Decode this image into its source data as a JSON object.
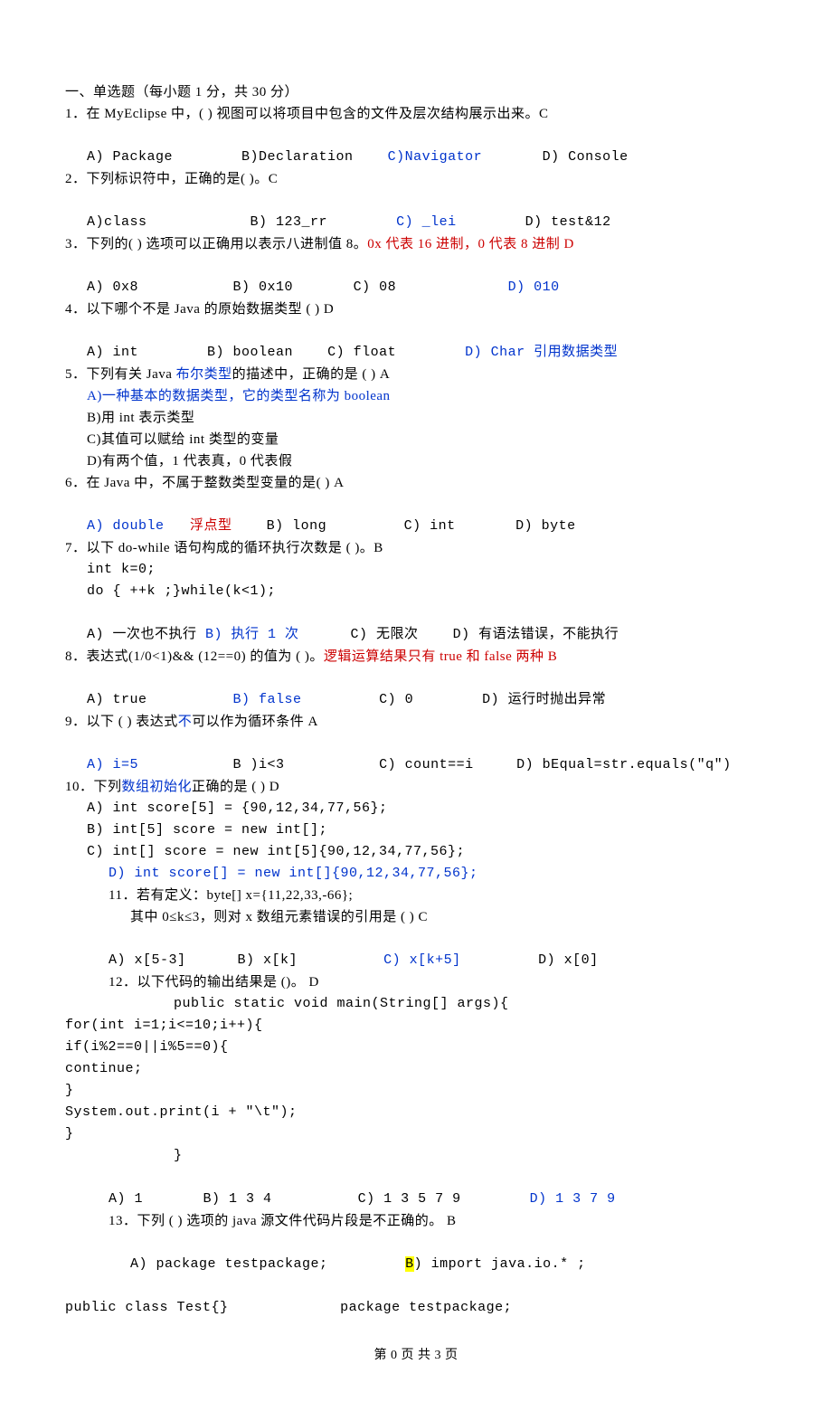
{
  "header": "一、单选题（每小题 1 分，共 30 分）",
  "q1": {
    "stem_a": "1．在 MyEclipse 中，(  ) 视图可以将项目中包含的文件及层次结构展示出来。C",
    "optA": "A) Package",
    "optB": "B)Declaration",
    "optC": "C)Navigator",
    "optD": "D) Console"
  },
  "q2": {
    "stem": "2．下列标识符中，正确的是(  )。C",
    "optA": "A)class",
    "optB": "B) 123_rr",
    "optC": "C) _lei",
    "optD": "D) test&12"
  },
  "q3": {
    "stem_a": "3．下列的(  ) 选项可以正确用以表示八进制值 8。",
    "stem_b": "0x 代表 16 进制，0 代表 8 进制 D",
    "optA": "A) 0x8",
    "optB": "B) 0x10",
    "optC": "C) 08",
    "optD": "D) 010"
  },
  "q4": {
    "stem": "4．以下哪个不是 Java 的原始数据类型 (  ) D",
    "optA": "A) int",
    "optB": "B) boolean",
    "optC": "C) float",
    "optD": "D) Char 引用数据类型"
  },
  "q5": {
    "stem_a": "5．下列有关 Java ",
    "stem_b": "布尔类型",
    "stem_c": "的描述中，正确的是 (  ) A",
    "optA": "A)一种基本的数据类型，它的类型名称为 boolean",
    "optB": "B)用 int 表示类型",
    "optC": "C)其值可以赋给 int 类型的变量",
    "optD": "D)有两个值，1 代表真，0 代表假"
  },
  "q6": {
    "stem": "6．在 Java 中，不属于整数类型变量的是(   ) A",
    "optA_a": "A) double",
    "optA_b": "浮点型",
    "optB": "B) long",
    "optC": "C) int",
    "optD": "D) byte"
  },
  "q7": {
    "stem": "7．以下 do-while 语句构成的循环执行次数是 (  )。B",
    "code1": "int k=0;",
    "code2": "do { ++k ;}while(k<1);",
    "optA": "A) 一次也不执行 ",
    "optB": "B) 执行 1 次",
    "optC": "C) 无限次",
    "optD": "D) 有语法错误，不能执行"
  },
  "q8": {
    "stem_a": "8．表达式(1/0<1)&& (12==0) 的值为 (  )。",
    "stem_b": "逻辑运算结果只有 true 和 false 两种 B",
    "optA": "A) true",
    "optB": "B) false",
    "optC": "C) 0",
    "optD": "D) 运行时抛出异常"
  },
  "q9": {
    "stem_a": "9．以下 (  ) 表达式",
    "stem_b": "不",
    "stem_c": "可以作为循环条件 A",
    "optA": "A) i=5",
    "optB": "B )i<3",
    "optC": "C) count==i",
    "optD": "D) bEqual=str.equals(\"q\")"
  },
  "q10": {
    "stem_a": "10．下列",
    "stem_b": "数组初始化",
    "stem_c": "正确的是 (  )  D",
    "optA": "A) int score[5] = {90,12,34,77,56};",
    "optB": "B) int[5] score = new int[];",
    "optC": "C) int[] score = new int[5]{90,12,34,77,56};",
    "optD": "D) int score[] = new int[]{90,12,34,77,56};"
  },
  "q11": {
    "stem1": "11．若有定义：byte[] x={11,22,33,-66};",
    "stem2": "其中 0≤k≤3，则对 x 数组元素错误的引用是 (  )  C",
    "optA": "A) x[5-3]",
    "optB": "B) x[k]",
    "optC": "C) x[k+5]",
    "optD": "D) x[0]"
  },
  "q12": {
    "stem": "12．以下代码的输出结果是 ()。 D",
    "c1": "public static void main(String[] args){",
    "c2": "for(int i=1;i<=10;i++){",
    "c3": "if(i%2==0||i%5==0){",
    "c4": "continue;",
    "c5": "}",
    "c6": "System.out.print(i + \"\\t\");",
    "c7": "}",
    "c8": "}",
    "optA": "A) 1",
    "optB": "B) 1 3 4",
    "optC": "C) 1 3 5 7 9",
    "optD": "D) 1 3 7 9"
  },
  "q13": {
    "stem": "13．下列 (  ) 选项的 java 源文件代码片段是不正确的。  B",
    "lineA_a": "A) package testpackage;",
    "lineA_b_pre": "B",
    "lineA_b_post": ") import java.io.* ;",
    "lineB_a": "public class Test{}",
    "lineB_b": "package testpackage;"
  },
  "footer": "第 0 页 共 3 页"
}
